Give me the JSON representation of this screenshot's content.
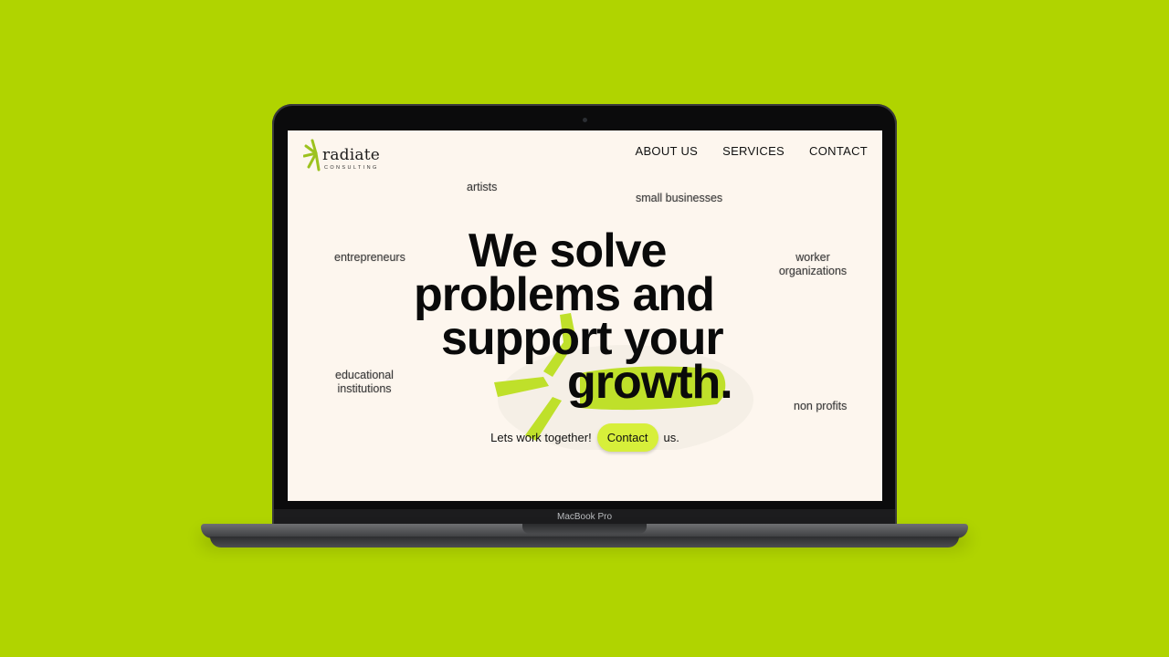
{
  "device": {
    "label": "MacBook Pro"
  },
  "site": {
    "logo": {
      "word": "radiate",
      "sub": "CONSULTING"
    },
    "nav": [
      {
        "label": "ABOUT US"
      },
      {
        "label": "SERVICES"
      },
      {
        "label": "CONTACT"
      }
    ],
    "tags": {
      "artists": "artists",
      "small_businesses": "small businesses",
      "entrepreneurs": "entrepreneurs",
      "worker_1": "worker",
      "worker_2": "organizations",
      "educational_1": "educational",
      "educational_2": "institutions",
      "non_profits": "non profits"
    },
    "headline": {
      "line1": "We solve",
      "line2": "problems and",
      "line3": "support your",
      "line4": "growth."
    },
    "cta": {
      "prefix": "Lets work together!",
      "button": "Contact",
      "suffix": "us."
    }
  },
  "colors": {
    "background": "#b0d400",
    "screen_bg": "#fdf6ee",
    "accent": "#d7ef3a",
    "brush": "#bfe02a"
  }
}
